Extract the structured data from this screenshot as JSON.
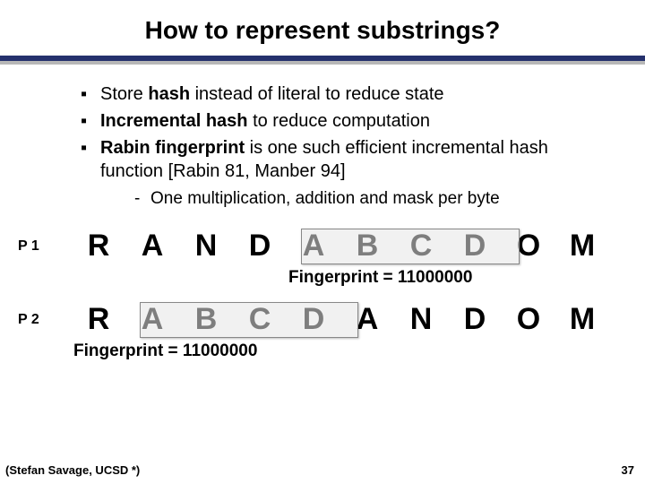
{
  "title": "How to represent substrings?",
  "bullets": {
    "b1_pre": "Store ",
    "b1_bold": "hash",
    "b1_post": " instead of literal to reduce state",
    "b2_pre": "",
    "b2_bold": "Incremental hash",
    "b2_post": " to reduce computation",
    "b3_pre": "",
    "b3_bold": "Rabin fingerprint",
    "b3_post": " is one such efficient incremental hash function [Rabin 81, Manber 94]",
    "sub1": "One multiplication, addition and mask per byte"
  },
  "seq": {
    "p1_label": "P 1",
    "p2_label": "P 2",
    "p1": [
      "R",
      "A",
      "N",
      "D",
      "A",
      "B",
      "C",
      "D",
      "O",
      "M"
    ],
    "p2": [
      "R",
      "A",
      "B",
      "C",
      "D",
      "A",
      "N",
      "D",
      "O",
      "M"
    ],
    "fp1": "Fingerprint = 11000000",
    "fp2": "Fingerprint = 11000000"
  },
  "credit": "(Stefan Savage, UCSD *)",
  "pagenum": "37",
  "markers": {
    "square": "▪",
    "dash": "-"
  }
}
